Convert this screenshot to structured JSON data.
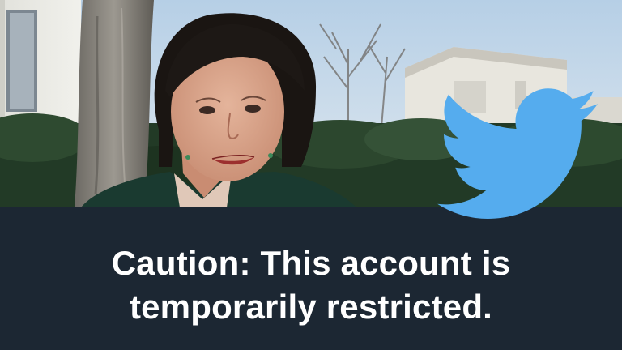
{
  "caution": {
    "line1": "Caution: This account is",
    "line2": "temporarily restricted."
  },
  "icons": {
    "logo": "twitter-bird-icon"
  },
  "colors": {
    "banner_background": "#1c2733",
    "caption_text": "#ffffff",
    "bird_blue": "#55acee"
  }
}
